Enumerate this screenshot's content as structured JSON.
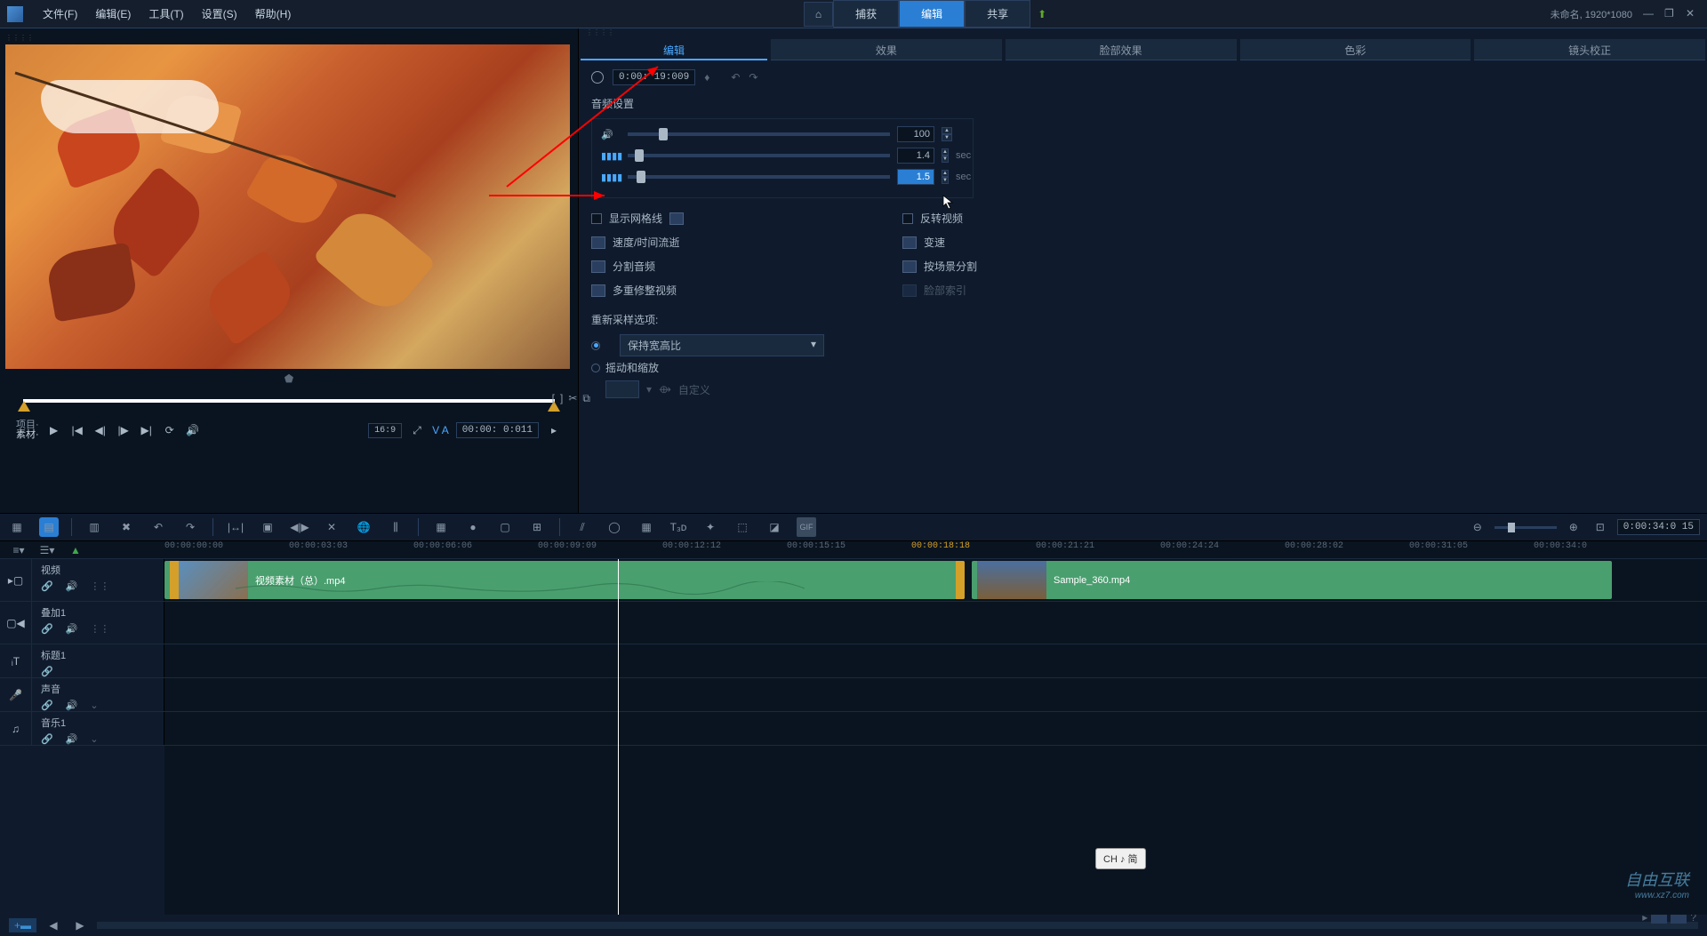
{
  "menu": {
    "file": "文件(F)",
    "edit": "编辑(E)",
    "tools": "工具(T)",
    "settings": "设置(S)",
    "help": "帮助(H)"
  },
  "top_tabs": {
    "home": "⌂",
    "capture": "捕获",
    "edit": "编辑",
    "share": "共享"
  },
  "status": {
    "project": "未命名, 1920*1080"
  },
  "preview": {
    "timecode": "0:00: 19:009",
    "project_label": "项目·",
    "material_label": "素材·",
    "aspect": "16:9",
    "va": "V A",
    "tc2": "00:00: 0:011"
  },
  "edit_tabs": {
    "edit": "编辑",
    "effects": "效果",
    "face": "脸部效果",
    "color": "色彩",
    "lens": "镜头校正"
  },
  "audio": {
    "section": "音频设置",
    "volume": "100",
    "fadein": "1.4",
    "fadeout": "1.5",
    "sec": "sec"
  },
  "options": {
    "grid": "显示网格线",
    "reverse": "反转视频",
    "speed": "速度/时间流逝",
    "varispeed": "变速",
    "split_audio": "分割音频",
    "scene_split": "按场景分割",
    "multi_trim": "多重修整视频",
    "face_index": "脸部索引"
  },
  "resample": {
    "label": "重新采样选项:",
    "keep_aspect": "保持宽高比",
    "pan_zoom": "摇动和缩放",
    "custom": "自定义"
  },
  "toolbar": {
    "tc": "0:00:34:0 15"
  },
  "ruler": {
    "t0": "00:00:00:00",
    "t1": "00:00:03:03",
    "t2": "00:00:06:06",
    "t3": "00:00:09:09",
    "t4": "00:00:12:12",
    "t5": "00:00:15:15",
    "t6": "00:00:18:18",
    "t7": "00:00:21:21",
    "t8": "00:00:24:24",
    "t9": "00:00:28:02",
    "t10": "00:00:31:05",
    "t11": "00:00:34:0"
  },
  "tracks": {
    "video": "视频",
    "overlay": "叠加1",
    "title": "标题1",
    "voice": "声音",
    "music": "音乐1"
  },
  "clips": {
    "c1": "视频素材（总）.mp4",
    "c2": "Sample_360.mp4"
  },
  "ime": "CH ♪ 简",
  "watermark": {
    "main": "自由互联",
    "sub": "www.xz7.com"
  }
}
